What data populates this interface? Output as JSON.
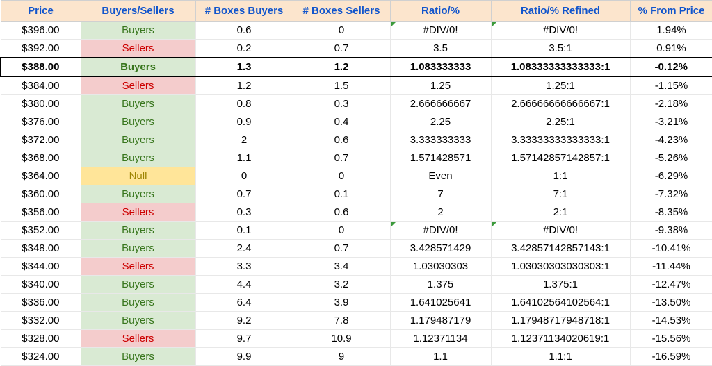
{
  "headers": [
    "Price",
    "Buyers/Sellers",
    "# Boxes Buyers",
    "# Boxes Sellers",
    "Ratio/%",
    "Ratio/% Refined",
    "% From Price"
  ],
  "rows": [
    {
      "price": "$396.00",
      "bs": "Buyers",
      "bb": "0.6",
      "bsell": "0",
      "ratio": "#DIV/0!",
      "refined": "#DIV/0!",
      "pct": "1.94%",
      "flag": true,
      "hl": false
    },
    {
      "price": "$392.00",
      "bs": "Sellers",
      "bb": "0.2",
      "bsell": "0.7",
      "ratio": "3.5",
      "refined": "3.5:1",
      "pct": "0.91%",
      "flag": false,
      "hl": false
    },
    {
      "price": "$388.00",
      "bs": "Buyers",
      "bb": "1.3",
      "bsell": "1.2",
      "ratio": "1.083333333",
      "refined": "1.08333333333333:1",
      "pct": "-0.12%",
      "flag": false,
      "hl": true
    },
    {
      "price": "$384.00",
      "bs": "Sellers",
      "bb": "1.2",
      "bsell": "1.5",
      "ratio": "1.25",
      "refined": "1.25:1",
      "pct": "-1.15%",
      "flag": false,
      "hl": false
    },
    {
      "price": "$380.00",
      "bs": "Buyers",
      "bb": "0.8",
      "bsell": "0.3",
      "ratio": "2.666666667",
      "refined": "2.66666666666667:1",
      "pct": "-2.18%",
      "flag": false,
      "hl": false
    },
    {
      "price": "$376.00",
      "bs": "Buyers",
      "bb": "0.9",
      "bsell": "0.4",
      "ratio": "2.25",
      "refined": "2.25:1",
      "pct": "-3.21%",
      "flag": false,
      "hl": false
    },
    {
      "price": "$372.00",
      "bs": "Buyers",
      "bb": "2",
      "bsell": "0.6",
      "ratio": "3.333333333",
      "refined": "3.33333333333333:1",
      "pct": "-4.23%",
      "flag": false,
      "hl": false
    },
    {
      "price": "$368.00",
      "bs": "Buyers",
      "bb": "1.1",
      "bsell": "0.7",
      "ratio": "1.571428571",
      "refined": "1.57142857142857:1",
      "pct": "-5.26%",
      "flag": false,
      "hl": false
    },
    {
      "price": "$364.00",
      "bs": "Null",
      "bb": "0",
      "bsell": "0",
      "ratio": "Even",
      "refined": "1:1",
      "pct": "-6.29%",
      "flag": false,
      "hl": false
    },
    {
      "price": "$360.00",
      "bs": "Buyers",
      "bb": "0.7",
      "bsell": "0.1",
      "ratio": "7",
      "refined": "7:1",
      "pct": "-7.32%",
      "flag": false,
      "hl": false
    },
    {
      "price": "$356.00",
      "bs": "Sellers",
      "bb": "0.3",
      "bsell": "0.6",
      "ratio": "2",
      "refined": "2:1",
      "pct": "-8.35%",
      "flag": false,
      "hl": false
    },
    {
      "price": "$352.00",
      "bs": "Buyers",
      "bb": "0.1",
      "bsell": "0",
      "ratio": "#DIV/0!",
      "refined": "#DIV/0!",
      "pct": "-9.38%",
      "flag": true,
      "hl": false
    },
    {
      "price": "$348.00",
      "bs": "Buyers",
      "bb": "2.4",
      "bsell": "0.7",
      "ratio": "3.428571429",
      "refined": "3.42857142857143:1",
      "pct": "-10.41%",
      "flag": false,
      "hl": false
    },
    {
      "price": "$344.00",
      "bs": "Sellers",
      "bb": "3.3",
      "bsell": "3.4",
      "ratio": "1.03030303",
      "refined": "1.03030303030303:1",
      "pct": "-11.44%",
      "flag": false,
      "hl": false
    },
    {
      "price": "$340.00",
      "bs": "Buyers",
      "bb": "4.4",
      "bsell": "3.2",
      "ratio": "1.375",
      "refined": "1.375:1",
      "pct": "-12.47%",
      "flag": false,
      "hl": false
    },
    {
      "price": "$336.00",
      "bs": "Buyers",
      "bb": "6.4",
      "bsell": "3.9",
      "ratio": "1.641025641",
      "refined": "1.64102564102564:1",
      "pct": "-13.50%",
      "flag": false,
      "hl": false
    },
    {
      "price": "$332.00",
      "bs": "Buyers",
      "bb": "9.2",
      "bsell": "7.8",
      "ratio": "1.179487179",
      "refined": "1.17948717948718:1",
      "pct": "-14.53%",
      "flag": false,
      "hl": false
    },
    {
      "price": "$328.00",
      "bs": "Sellers",
      "bb": "9.7",
      "bsell": "10.9",
      "ratio": "1.12371134",
      "refined": "1.12371134020619:1",
      "pct": "-15.56%",
      "flag": false,
      "hl": false
    },
    {
      "price": "$324.00",
      "bs": "Buyers",
      "bb": "9.9",
      "bsell": "9",
      "ratio": "1.1",
      "refined": "1.1:1",
      "pct": "-16.59%",
      "flag": false,
      "hl": false
    }
  ]
}
